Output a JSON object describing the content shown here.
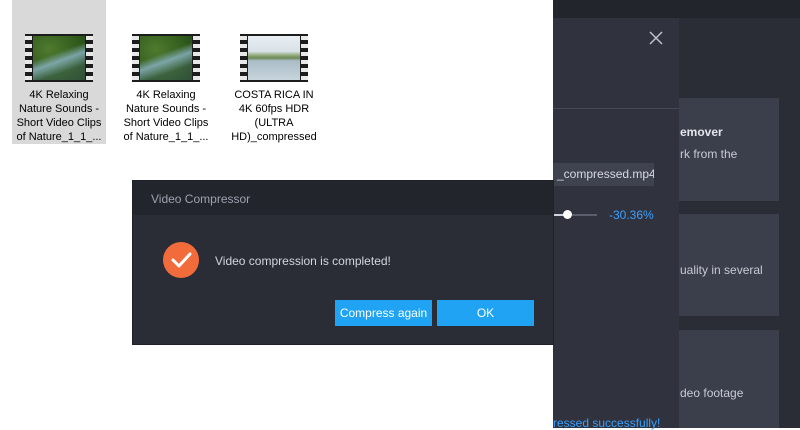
{
  "explorer": {
    "files": [
      {
        "label": "4K Relaxing Nature Sounds - Short Video Clips of Nature_1_1_...",
        "thumb": "forest",
        "selected": true
      },
      {
        "label": "4K Relaxing Nature Sounds - Short Video Clips of Nature_1_1_...",
        "thumb": "forest",
        "selected": false
      },
      {
        "label": "COSTA RICA IN 4K 60fps HDR (ULTRA HD)_compressed",
        "thumb": "lake",
        "selected": false
      }
    ]
  },
  "app": {
    "output_file": "_compressed.mp4",
    "percent": "-30.36%",
    "success_text": "ressed successfully!",
    "cards": [
      {
        "title": "emover",
        "text": "rk from the"
      },
      {
        "text": "uality in several"
      },
      {
        "text": "deo footage"
      }
    ]
  },
  "modal": {
    "title": "Video Compressor",
    "message": "Video compression is completed!",
    "compress_again_label": "Compress again",
    "ok_label": "OK"
  },
  "colors": {
    "accent": "#1fa3f2",
    "success": "#f26b3a",
    "link": "#3aa0ff"
  },
  "icons": {
    "close": "close-icon",
    "success": "check-circle-icon",
    "video": "video-file-icon"
  }
}
